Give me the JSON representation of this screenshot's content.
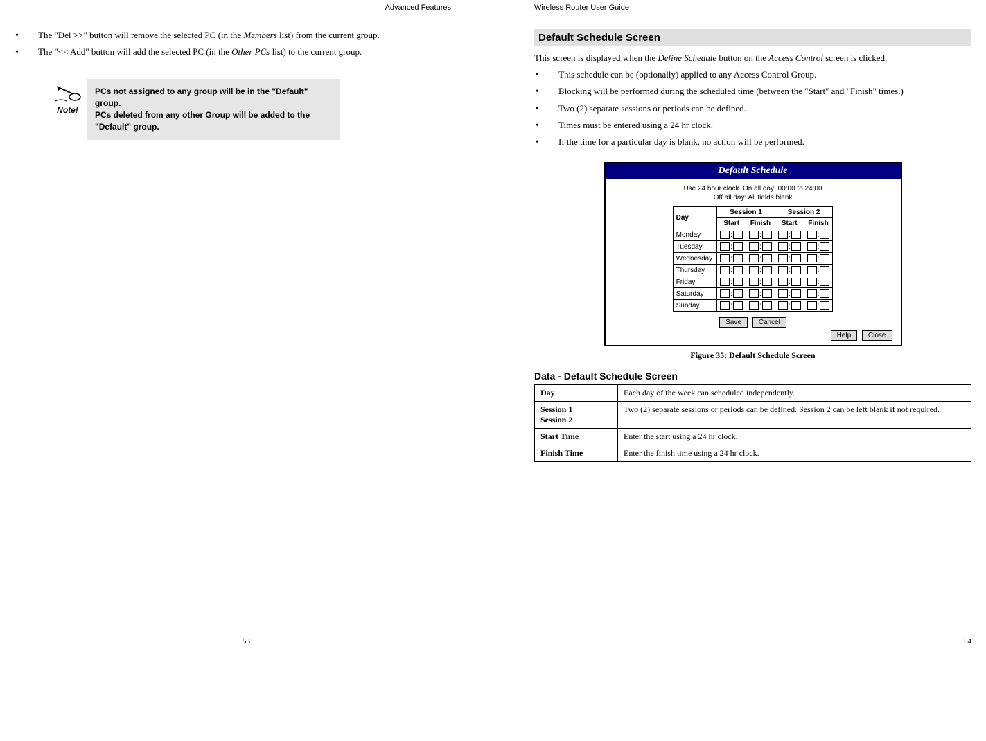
{
  "left": {
    "header": "Advanced Features",
    "bullets": [
      {
        "pre": "The \"Del >>\" button will remove the selected PC (in the ",
        "em": "Members",
        "post": " list) from the current group."
      },
      {
        "pre": "The \"<< Add\" button will add the selected PC (in the ",
        "em": "Other PCs",
        "post": "  list) to the current group."
      }
    ],
    "note_icon_label": "Note!",
    "note_line1": "PCs not assigned to any group will be in the \"Default\" group.",
    "note_line2": "PCs deleted from any other Group will be added to the \"Default\" group.",
    "page_num": "53"
  },
  "right": {
    "header": "Wireless Router User Guide",
    "section_title": "Default Schedule Screen",
    "intro_pre": "This screen is displayed when the ",
    "intro_em1": "Define Schedule",
    "intro_mid": " button on the  ",
    "intro_em2": "Access Control",
    "intro_post": " screen is clicked.",
    "bullets": [
      "This schedule can be (optionally) applied to any Access Control Group.",
      "Blocking will be performed during the scheduled time (between the \"Start\" and \"Finish\" times.)",
      "Two (2) separate sessions or periods can be defined.",
      "Times must be entered using a 24 hr clock.",
      "If the time for a particular day is blank, no action will be performed."
    ],
    "figure": {
      "title": "Default Schedule",
      "hint1": "Use 24 hour clock.   On all day: 00:00 to 24:00",
      "hint2": "Off all day:  All fields blank",
      "col_day": "Day",
      "col_s1": "Session 1",
      "col_s2": "Session 2",
      "sub_start": "Start",
      "sub_finish": "Finish",
      "days": [
        "Monday",
        "Tuesday",
        "Wednesday",
        "Thursday",
        "Friday",
        "Saturday",
        "Sunday"
      ],
      "btn_save": "Save",
      "btn_cancel": "Cancel",
      "btn_help": "Help",
      "btn_close": "Close"
    },
    "figure_caption": "Figure 35: Default Schedule Screen",
    "data_heading": "Data - Default Schedule Screen",
    "data_rows": [
      {
        "label": "Day",
        "desc": "Each day of the week can scheduled independently."
      },
      {
        "label": "Session 1\nSession 2",
        "desc": "Two (2) separate sessions or periods can be defined. Session 2 can be left blank if not required."
      },
      {
        "label": "Start Time",
        "desc": "Enter the start using a 24 hr clock."
      },
      {
        "label": "Finish Time",
        "desc": "Enter the finish time using a 24 hr clock."
      }
    ],
    "page_num": "54"
  }
}
